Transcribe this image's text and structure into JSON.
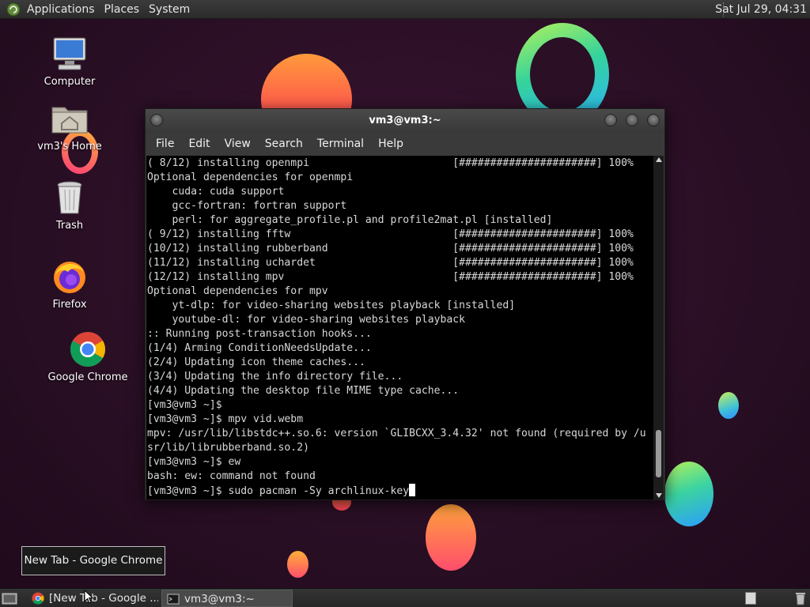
{
  "top_panel": {
    "menus": [
      "Applications",
      "Places",
      "System"
    ],
    "clock": "Sat Jul 29, 04:31"
  },
  "desktop_icons": {
    "computer": "Computer",
    "home": "vm3's Home",
    "trash": "Trash",
    "firefox": "Firefox",
    "chrome": "Google Chrome"
  },
  "terminal": {
    "title": "vm3@vm3:~",
    "menu": [
      "File",
      "Edit",
      "View",
      "Search",
      "Terminal",
      "Help"
    ],
    "lines": [
      "( 8/12) installing openmpi                       [######################] 100%",
      "Optional dependencies for openmpi",
      "    cuda: cuda support",
      "    gcc-fortran: fortran support",
      "    perl: for aggregate_profile.pl and profile2mat.pl [installed]",
      "( 9/12) installing fftw                          [######################] 100%",
      "(10/12) installing rubberband                    [######################] 100%",
      "(11/12) installing uchardet                      [######################] 100%",
      "(12/12) installing mpv                           [######################] 100%",
      "Optional dependencies for mpv",
      "    yt-dlp: for video-sharing websites playback [installed]",
      "    youtube-dl: for video-sharing websites playback",
      ":: Running post-transaction hooks...",
      "(1/4) Arming ConditionNeedsUpdate...",
      "(2/4) Updating icon theme caches...",
      "(3/4) Updating the info directory file...",
      "(4/4) Updating the desktop file MIME type cache...",
      "[vm3@vm3 ~]$",
      "[vm3@vm3 ~]$ mpv vid.webm",
      "mpv: /usr/lib/libstdc++.so.6: version `GLIBCXX_3.4.32' not found (required by /u",
      "sr/lib/librubberband.so.2)",
      "[vm3@vm3 ~]$ ew",
      "bash: ew: command not found"
    ],
    "prompt_line": "[vm3@vm3 ~]$ sudo pacman -Sy archlinux-key",
    "scroll_position": 0.95
  },
  "tooltip": "New Tab - Google Chrome",
  "taskbar": {
    "tasks": [
      "[New Tab - Google ...",
      "vm3@vm3:~"
    ]
  }
}
